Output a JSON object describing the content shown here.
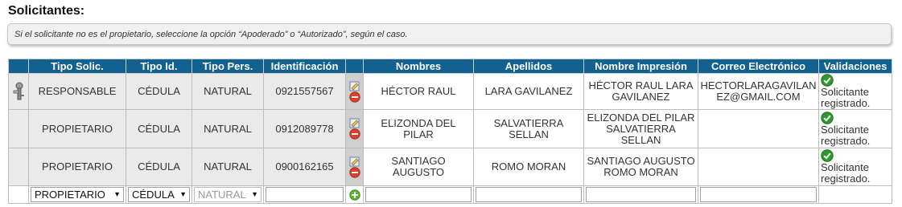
{
  "section_title": "Solicitantes:",
  "note": "Si el solicitante no es el propietario, seleccione la opción “Apoderado” o “Autorizado”, según el caso.",
  "columns": {
    "tipo_solic": "Tipo Solic.",
    "tipo_id": "Tipo Id.",
    "tipo_pers": "Tipo Pers.",
    "identificacion": "Identificación",
    "nombres": "Nombres",
    "apellidos": "Apellidos",
    "nombre_impresion": "Nombre Impresión",
    "correo": "Correo Electrónico",
    "validaciones": "Validaciones"
  },
  "rows": [
    {
      "tipo_solic": "RESPONSABLE",
      "tipo_id": "CÉDULA",
      "tipo_pers": "NATURAL",
      "identificacion": "0921557567",
      "nombres": "HÉCTOR RAUL",
      "apellidos": "LARA GAVILANEZ",
      "nombre_impresion": "HÉCTOR RAUL LARA GAVILANEZ",
      "correo": "HECTORLARAGAVILANEZ@GMAIL.COM",
      "validacion": "Solicitante registrado."
    },
    {
      "tipo_solic": "PROPIETARIO",
      "tipo_id": "CÉDULA",
      "tipo_pers": "NATURAL",
      "identificacion": "0912089778",
      "nombres": "ELIZONDA DEL PILAR",
      "apellidos": "SALVATIERRA SELLAN",
      "nombre_impresion": "ELIZONDA DEL PILAR SALVATIERRA SELLAN",
      "correo": "",
      "validacion": "Solicitante registrado."
    },
    {
      "tipo_solic": "PROPIETARIO",
      "tipo_id": "CÉDULA",
      "tipo_pers": "NATURAL",
      "identificacion": "0900162165",
      "nombres": "SANTIAGO AUGUSTO",
      "apellidos": "ROMO MORAN",
      "nombre_impresion": "SANTIAGO AUGUSTO ROMO MORAN",
      "correo": "",
      "validacion": "Solicitante registrado."
    }
  ],
  "new_row": {
    "tipo_solic_value": "PROPIETARIO",
    "tipo_id_value": "CÉDULA",
    "tipo_pers_value": "NATURAL",
    "identificacion_value": "",
    "nombres_value": "",
    "apellidos_value": "",
    "nombre_impresion_value": "",
    "correo_value": ""
  },
  "colors": {
    "header_bg": "#13618f",
    "valid_icon": "#2e9a2e",
    "remove_icon": "#d9412c",
    "add_icon": "#5cb82a"
  },
  "icons": {
    "responsible": "key-person-icon",
    "edit": "edit-icon",
    "remove": "remove-icon",
    "add": "add-icon",
    "valid": "check-circle-icon"
  }
}
